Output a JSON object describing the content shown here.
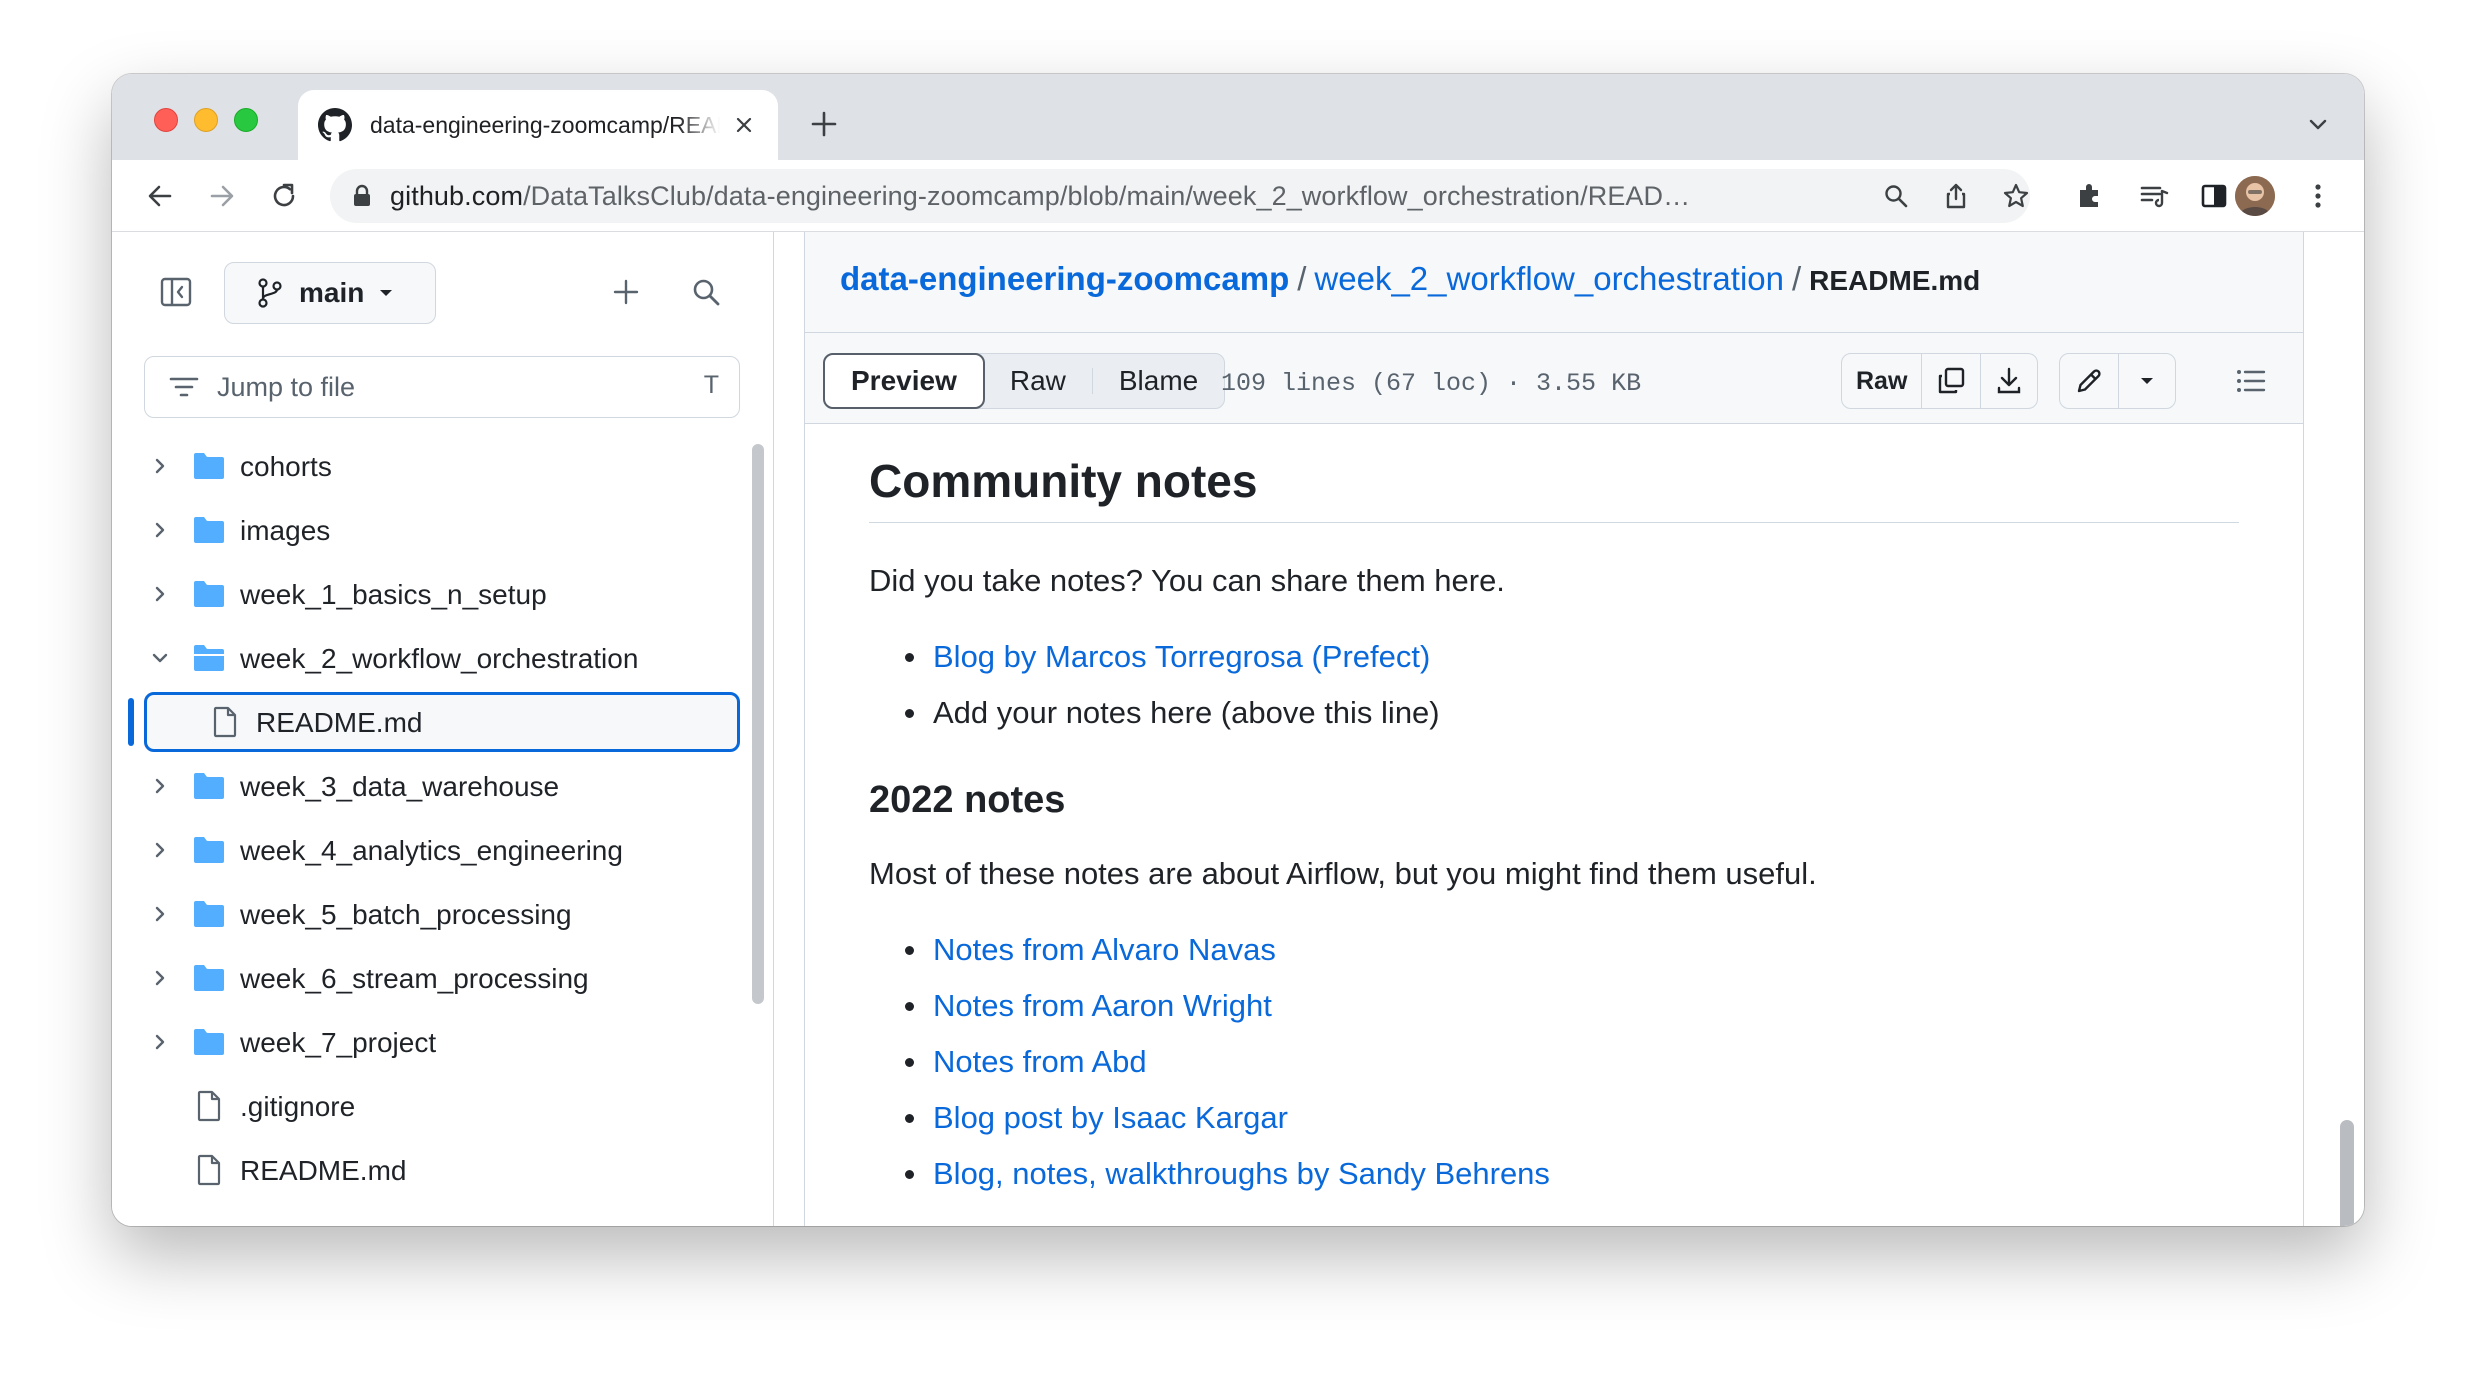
{
  "browser": {
    "tab_title": "data-engineering-zoomcamp/README.md at main · DataTalksClub/data-engineering-zoomcamp",
    "url_host": "github.com",
    "url_path": "/DataTalksClub/data-engineering-zoomcamp/blob/main/week_2_workflow_orchestration/READ…"
  },
  "sidebar": {
    "branch": "main",
    "jump_placeholder": "Jump to file",
    "jump_shortcut": "T",
    "tree": [
      {
        "name": "cohorts",
        "type": "folder"
      },
      {
        "name": "images",
        "type": "folder"
      },
      {
        "name": "week_1_basics_n_setup",
        "type": "folder"
      },
      {
        "name": "week_2_workflow_orchestration",
        "type": "folder-open"
      },
      {
        "name": "README.md",
        "type": "file-selected"
      },
      {
        "name": "week_3_data_warehouse",
        "type": "folder"
      },
      {
        "name": "week_4_analytics_engineering",
        "type": "folder"
      },
      {
        "name": "week_5_batch_processing",
        "type": "folder"
      },
      {
        "name": "week_6_stream_processing",
        "type": "folder"
      },
      {
        "name": "week_7_project",
        "type": "folder"
      },
      {
        "name": ".gitignore",
        "type": "file"
      },
      {
        "name": "README.md",
        "type": "file"
      }
    ]
  },
  "breadcrumb": {
    "repo": "data-engineering-zoomcamp",
    "sep": "/",
    "folder": "week_2_workflow_orchestration",
    "file": "README.md"
  },
  "filebar": {
    "tabs": [
      "Preview",
      "Raw",
      "Blame"
    ],
    "meta": "109 lines (67 loc) · 3.55 KB",
    "raw_label": "Raw"
  },
  "readme": {
    "h2": "Community notes",
    "p1": "Did you take notes? You can share them here.",
    "list1": [
      {
        "text": "Blog by Marcos Torregrosa (Prefect)",
        "link": true
      },
      {
        "text": "Add your notes here (above this line)",
        "link": false
      }
    ],
    "h3": "2022 notes",
    "p2": "Most of these notes are about Airflow, but you might find them useful.",
    "list2": [
      "Notes from Alvaro Navas",
      "Notes from Aaron Wright",
      "Notes from Abd",
      "Blog post by Isaac Kargar",
      "Blog, notes, walkthroughs by Sandy Behrens"
    ]
  },
  "colors": {
    "link": "#0969da",
    "folder": "#54aeff",
    "text": "#1f2328"
  }
}
